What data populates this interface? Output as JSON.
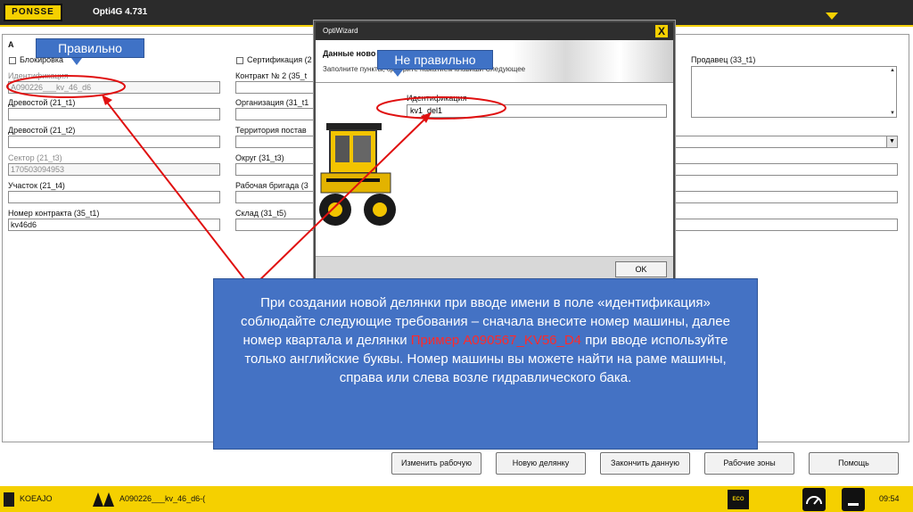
{
  "app": {
    "logo": "PONSSE",
    "version": "Opti4G 4.731"
  },
  "form": {
    "section_letter": "A",
    "left": {
      "lock_label": "Блокировка",
      "identification_label": "Идентификация",
      "identification_value": "A090226___kv_46_d6",
      "stand1_label": "Древостой (21_t1)",
      "stand2_label": "Древостой (21_t2)",
      "sector_label": "Сектор (21_t3)",
      "sector_value": "170503094953",
      "plot_label": "Участок (21_t4)",
      "contract_label": "Номер контракта (35_t1)",
      "contract_value": "kv46d6"
    },
    "mid": {
      "cert_label": "Сертификация (2",
      "contract2_label": "Контракт № 2 (35_t",
      "org_label": "Организация (31_t1",
      "territory_label": "Территория постав",
      "district_label": "Округ (31_t3)",
      "brigade_label": "Рабочая бригада (3",
      "warehouse_label": "Склад (31_t5)"
    },
    "right": {
      "seller_label": "Продавец (33_t1)"
    }
  },
  "dialog": {
    "title": "OptiWizard",
    "close": "X",
    "header_title": "Данные ново",
    "header_subtitle": "Заполните пункты, одобрите нажатием клавиши Следующее",
    "field_label": "Идентификация",
    "field_value": "kv1_del1",
    "ok_label": "OK"
  },
  "callouts": {
    "correct": "Правильно",
    "incorrect": "Не правильно"
  },
  "info": {
    "part1": "При создании новой делянки при вводе имени в поле «идентификация» соблюдайте следующие требования – сначала внесите номер машины, далее номер квартала и делянки",
    "example_red": "Пример A090567_KV56_D4",
    "part2": "при вводе используйте только английские буквы. Номер машины вы можете найти на раме машины, справа или слева возле гидравлического бака."
  },
  "buttons": {
    "change_work": "Изменить рабочую",
    "new_plot": "Новую делянку",
    "finish": "Закончить данную",
    "work_zones": "Рабочие зоны",
    "help": "Помощь"
  },
  "status": {
    "operator": "KOEAJO",
    "plot": "A090226___kv_46_d6-(",
    "eco": "ECO",
    "time": "09:54"
  },
  "colors": {
    "brand_yellow": "#f5d000",
    "callout_blue": "#4472c4",
    "annotation_red": "#e01010"
  },
  "icons": [
    "user-icon",
    "trees-icon",
    "eco-icon",
    "gauge-icon",
    "menu-arrow-icon"
  ]
}
